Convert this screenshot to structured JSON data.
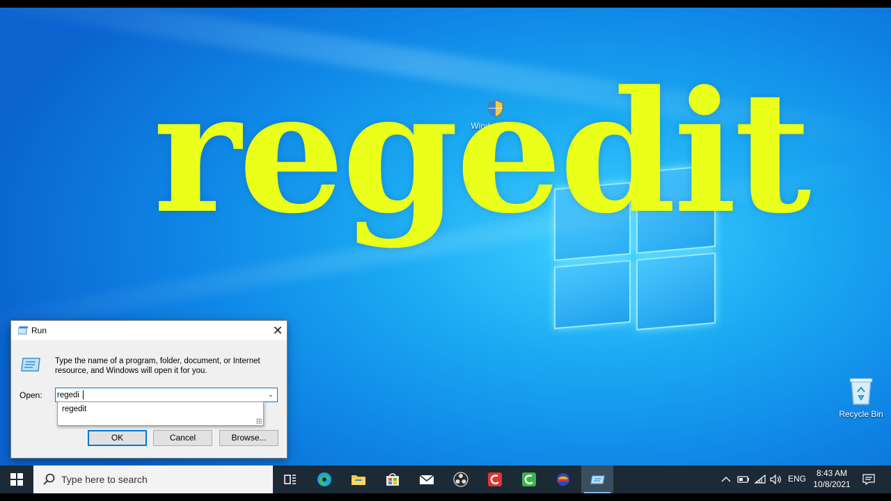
{
  "overlay": {
    "title": "regedit"
  },
  "desktop": {
    "icons": [
      {
        "label": "Windows11..."
      },
      {
        "label": "Recycle Bin"
      }
    ]
  },
  "run_dialog": {
    "title": "Run",
    "close": "✕",
    "description": "Type the name of a program, folder, document, or Internet resource, and Windows will open it for you.",
    "open_label": "Open:",
    "input_value": "regedi",
    "autocomplete": [
      "regedit"
    ],
    "buttons": {
      "ok": "OK",
      "cancel": "Cancel",
      "browse": "Browse..."
    }
  },
  "taskbar": {
    "search_placeholder": "Type here to search",
    "pinned": [
      "task-view",
      "edge",
      "file-explorer",
      "microsoft-store",
      "mail",
      "obs-studio",
      "camtasia-red",
      "camtasia-green",
      "app-orange",
      "run"
    ],
    "tray": {
      "language": "ENG",
      "time": "8:43 AM",
      "date": "10/8/2021"
    }
  },
  "colors": {
    "overlay_text": "#eaff1a",
    "accent": "#0078d7",
    "taskbar": "#1c2a36"
  }
}
